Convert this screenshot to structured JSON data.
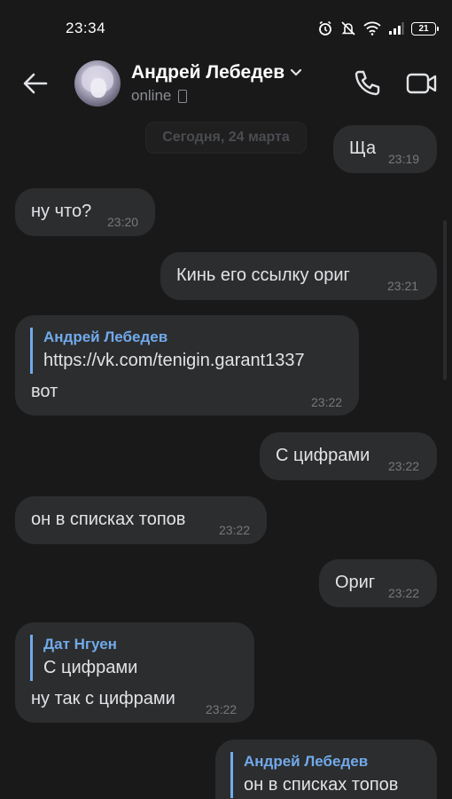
{
  "status_bar": {
    "time": "23:34",
    "battery": "21",
    "icons": [
      "alarm-icon",
      "mute-icon",
      "wifi-icon",
      "signal-icon",
      "battery-icon"
    ]
  },
  "header": {
    "contact_name": "Андрей Лебедев",
    "status": "online",
    "icons": [
      "back-arrow-icon",
      "chevron-down-icon",
      "mobile-device-icon",
      "phone-icon",
      "video-camera-icon"
    ]
  },
  "chat": {
    "date_divider": "Сегодня, 24 марта",
    "messages": [
      {
        "direction": "out",
        "text": "Ща",
        "time": "23:19"
      },
      {
        "direction": "in",
        "text": "ну что?",
        "time": "23:20"
      },
      {
        "direction": "out",
        "text": "Кинь его ссылку ориг",
        "time": "23:21"
      },
      {
        "direction": "in",
        "reply_author": "Андрей Лебедев",
        "reply_text": "https://vk.com/tenigin.garant1337",
        "text": "вот",
        "time": "23:22"
      },
      {
        "direction": "out",
        "text": "С цифрами",
        "time": "23:22"
      },
      {
        "direction": "in",
        "text": "он в списках топов",
        "time": "23:22"
      },
      {
        "direction": "out",
        "text": "Ориг",
        "time": "23:22"
      },
      {
        "direction": "in",
        "reply_author": "Дат Нгуен",
        "reply_text": "С цифрами",
        "text": "ну так с цифрами",
        "time": "23:22"
      },
      {
        "direction": "out",
        "reply_author": "Андрей Лебедев",
        "reply_text": "он в списках топов",
        "text": "",
        "time": ""
      }
    ]
  },
  "colors": {
    "background": "#19191a",
    "bubble": "#2c2d2e",
    "accent": "#71aaeb",
    "time_text": "#76787a"
  }
}
